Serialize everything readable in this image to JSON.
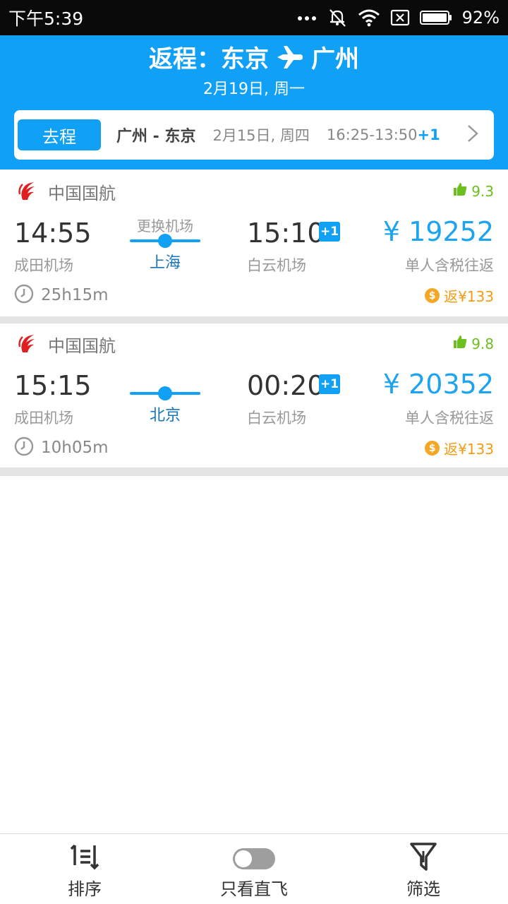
{
  "status_bar": {
    "time": "下午5:39",
    "battery": "92%",
    "icons": [
      "more-dots-icon",
      "silent-bell-icon",
      "wifi-icon",
      "sim-off-icon",
      "battery-icon"
    ]
  },
  "header": {
    "origin": "返程：东京",
    "destination": "广州",
    "date": "2月19日, 周一",
    "background_color": "#10a0f5"
  },
  "outbound": {
    "tag": "去程",
    "route": "广州 - 东京",
    "date": "2月15日, 周四",
    "time": "16:25-13:50",
    "day_offset": "+1"
  },
  "flights": [
    {
      "airline": "中国国航",
      "rating": "9.3",
      "dep_time": "14:55",
      "dep_airport": "成田机场",
      "transfer_note": "更换机场",
      "via": "上海",
      "arr_time": "15:10",
      "day_offset": "+1",
      "arr_airport": "白云机场",
      "price": "¥ 19252",
      "price_note": "单人含税往返",
      "duration": "25h15m",
      "cashback": "返¥133"
    },
    {
      "airline": "中国国航",
      "rating": "9.8",
      "dep_time": "15:15",
      "dep_airport": "成田机场",
      "transfer_note": "",
      "via": "北京",
      "arr_time": "00:20",
      "day_offset": "+1",
      "arr_airport": "白云机场",
      "price": "¥ 20352",
      "price_note": "单人含税往返",
      "duration": "10h05m",
      "cashback": "返¥133"
    }
  ],
  "bottom_bar": {
    "sort_label": "排序",
    "direct_label": "只看直飞",
    "direct_on": false,
    "filter_label": "筛选"
  }
}
